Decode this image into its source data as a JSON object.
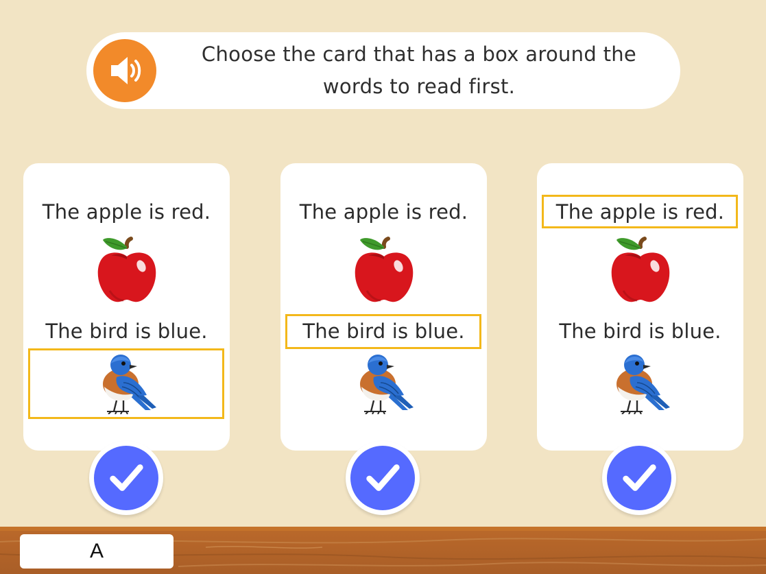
{
  "prompt": {
    "text": "Choose the card that has a box around the words to read first.",
    "audio_icon": "speaker-icon"
  },
  "cards": [
    {
      "sentence_1": "The apple is red.",
      "sentence_2": "The bird is blue.",
      "highlight": "bird-picture"
    },
    {
      "sentence_1": "The apple is red.",
      "sentence_2": "The bird is blue.",
      "highlight": "bird-sentence"
    },
    {
      "sentence_1": "The apple is red.",
      "sentence_2": "The bird is blue.",
      "highlight": "apple-sentence"
    }
  ],
  "answer_icon": "checkmark-icon",
  "answer_label": "A",
  "colors": {
    "background": "#f2e4c4",
    "audio_button": "#f28a2a",
    "check_button": "#556aff",
    "highlight_box": "#f3b81a",
    "floor": "#b9682a"
  }
}
